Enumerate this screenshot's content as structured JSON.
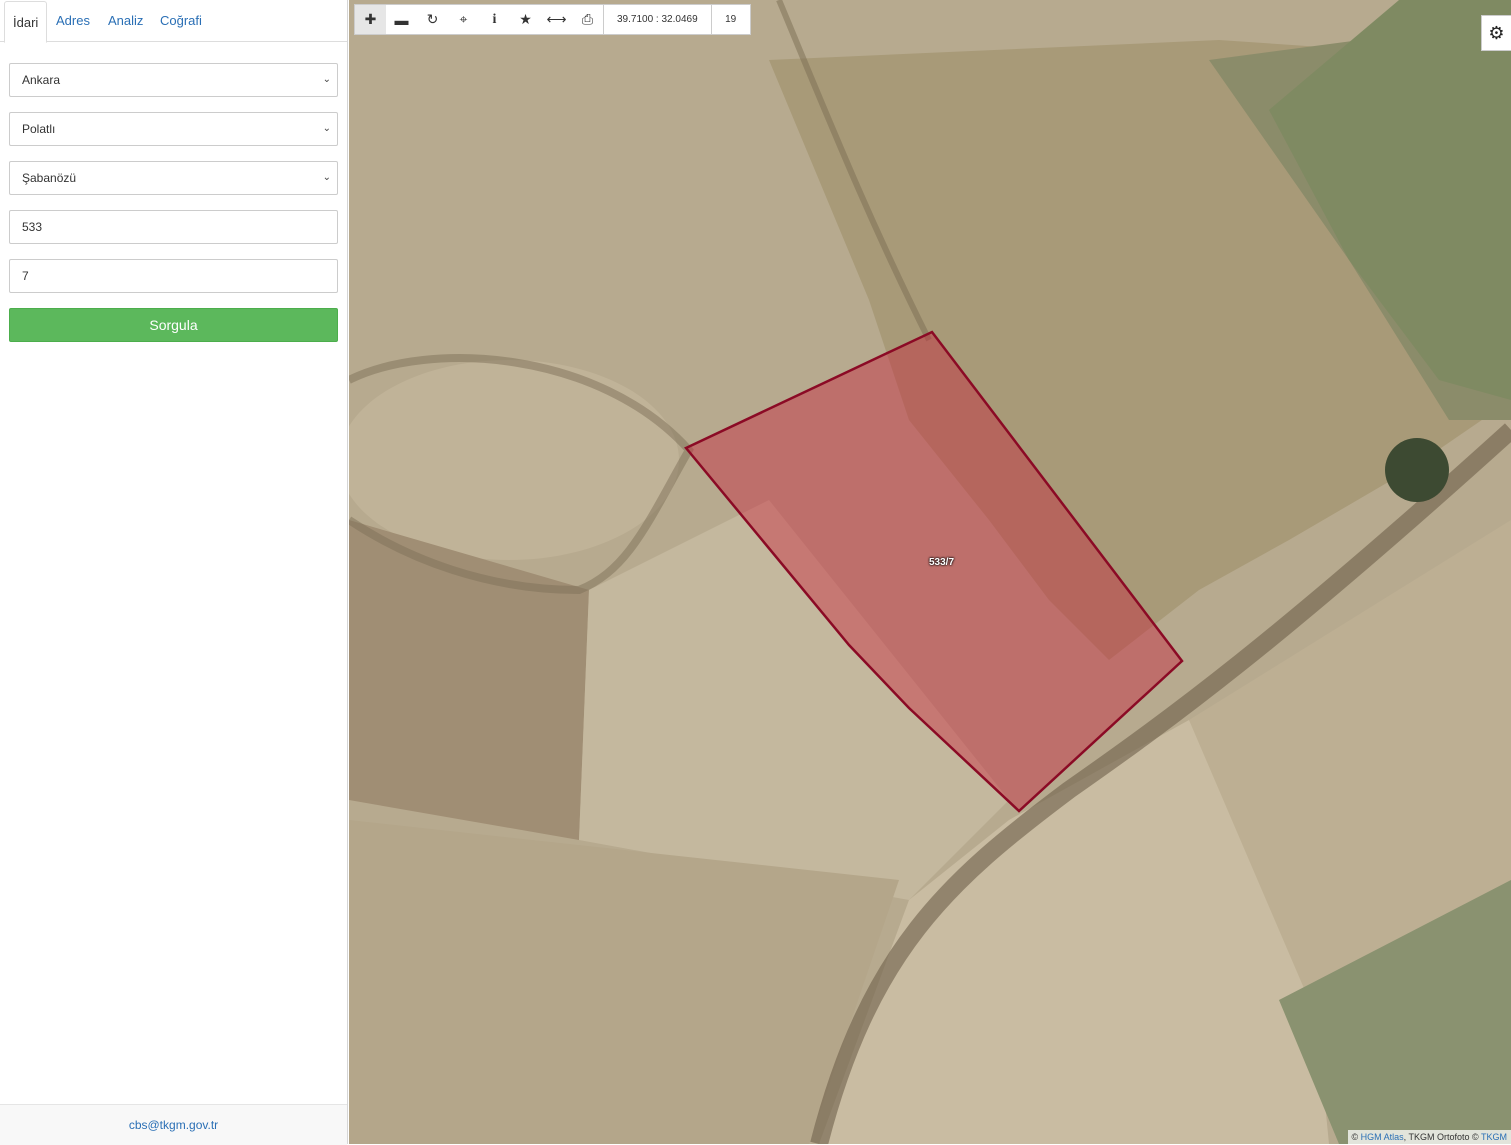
{
  "tabs": [
    {
      "label": "İdari",
      "active": true
    },
    {
      "label": "Adres",
      "active": false
    },
    {
      "label": "Analiz",
      "active": false
    },
    {
      "label": "Coğrafi",
      "active": false
    }
  ],
  "form": {
    "province": "Ankara",
    "district": "Polatlı",
    "neighborhood": "Şabanözü",
    "block": "533",
    "parcel": "7",
    "submit_label": "Sorgula"
  },
  "footer": {
    "email": "cbs@tkgm.gov.tr"
  },
  "toolbar": {
    "icons": [
      "zoom-in-icon",
      "zoom-out-icon",
      "refresh-icon",
      "locate-icon",
      "info-icon",
      "star-icon",
      "measure-icon",
      "print-icon"
    ],
    "coordinates": "39.7100 : 32.0469",
    "zoom": "19"
  },
  "map": {
    "parcel_label": "533/7",
    "parcel_color": "#c8203a",
    "attribution_prefix": "©",
    "attribution_link1": "HGM Atlas",
    "attribution_mid": ", TKGM Ortofoto ©",
    "attribution_link2": "TKGM"
  },
  "colors": {
    "accent": "#2a6fb5",
    "button": "#5cb85c"
  }
}
